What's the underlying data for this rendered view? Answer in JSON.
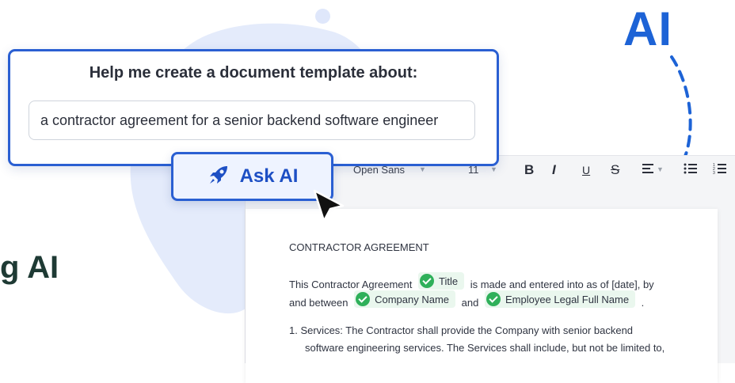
{
  "headline_ai": "AI",
  "left_heading": "g AI",
  "prompt": {
    "title": "Help me create a document template about:",
    "value": "a contractor agreement for a senior backend software engineer"
  },
  "ask_button": {
    "label": "Ask AI",
    "icon": "rocket-icon"
  },
  "toolbar": {
    "font": "Open Sans",
    "size": "11",
    "bold": "B",
    "italic": "I",
    "underline": "U",
    "strike": "S"
  },
  "document": {
    "heading": "CONTRACTOR AGREEMENT",
    "p1_part1": "This Contractor Agreement",
    "chip_title": "Title",
    "p1_part2": "is made and entered into as of [date], by",
    "p2_part1": "and between",
    "chip_company": "Company Name",
    "p2_and": "and",
    "chip_employee": "Employee Legal Full Name",
    "p2_end": ".",
    "item1_line1": "1. Services: The Contractor shall provide the Company with senior backend",
    "item1_line2": "software engineering services. The Services shall include, but not be limited to,"
  },
  "colors": {
    "brand_blue": "#2a5fd2",
    "check_green": "#2fb05a",
    "blob": "#e4ebfb"
  }
}
